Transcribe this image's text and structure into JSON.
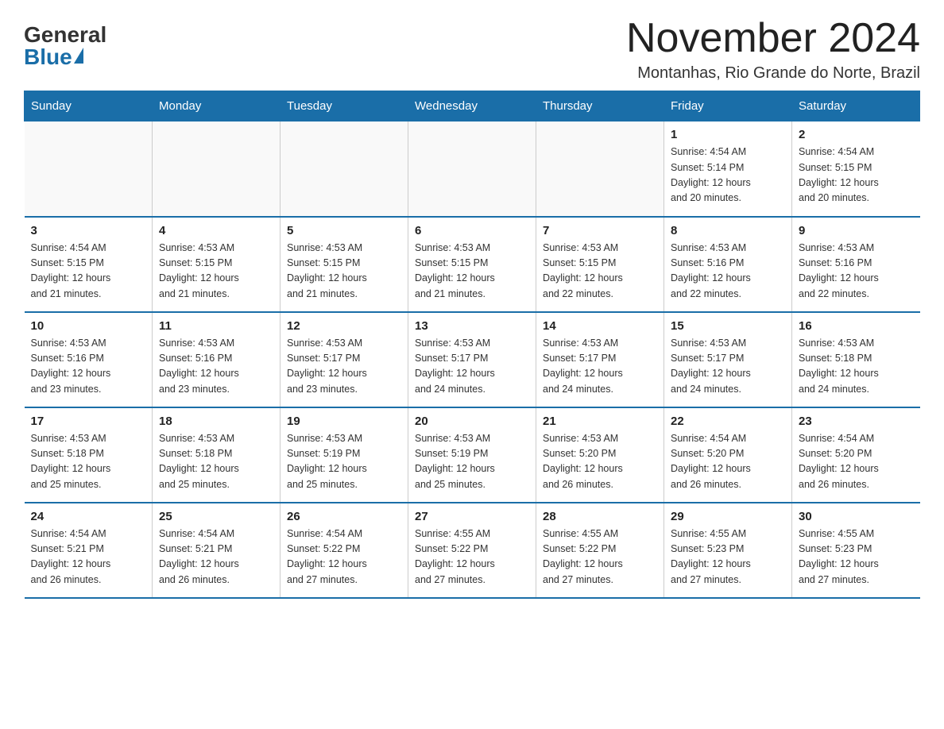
{
  "logo": {
    "general": "General",
    "blue": "Blue"
  },
  "header": {
    "title": "November 2024",
    "location": "Montanhas, Rio Grande do Norte, Brazil"
  },
  "weekdays": [
    "Sunday",
    "Monday",
    "Tuesday",
    "Wednesday",
    "Thursday",
    "Friday",
    "Saturday"
  ],
  "weeks": [
    [
      {
        "day": "",
        "info": ""
      },
      {
        "day": "",
        "info": ""
      },
      {
        "day": "",
        "info": ""
      },
      {
        "day": "",
        "info": ""
      },
      {
        "day": "",
        "info": ""
      },
      {
        "day": "1",
        "info": "Sunrise: 4:54 AM\nSunset: 5:14 PM\nDaylight: 12 hours\nand 20 minutes."
      },
      {
        "day": "2",
        "info": "Sunrise: 4:54 AM\nSunset: 5:15 PM\nDaylight: 12 hours\nand 20 minutes."
      }
    ],
    [
      {
        "day": "3",
        "info": "Sunrise: 4:54 AM\nSunset: 5:15 PM\nDaylight: 12 hours\nand 21 minutes."
      },
      {
        "day": "4",
        "info": "Sunrise: 4:53 AM\nSunset: 5:15 PM\nDaylight: 12 hours\nand 21 minutes."
      },
      {
        "day": "5",
        "info": "Sunrise: 4:53 AM\nSunset: 5:15 PM\nDaylight: 12 hours\nand 21 minutes."
      },
      {
        "day": "6",
        "info": "Sunrise: 4:53 AM\nSunset: 5:15 PM\nDaylight: 12 hours\nand 21 minutes."
      },
      {
        "day": "7",
        "info": "Sunrise: 4:53 AM\nSunset: 5:15 PM\nDaylight: 12 hours\nand 22 minutes."
      },
      {
        "day": "8",
        "info": "Sunrise: 4:53 AM\nSunset: 5:16 PM\nDaylight: 12 hours\nand 22 minutes."
      },
      {
        "day": "9",
        "info": "Sunrise: 4:53 AM\nSunset: 5:16 PM\nDaylight: 12 hours\nand 22 minutes."
      }
    ],
    [
      {
        "day": "10",
        "info": "Sunrise: 4:53 AM\nSunset: 5:16 PM\nDaylight: 12 hours\nand 23 minutes."
      },
      {
        "day": "11",
        "info": "Sunrise: 4:53 AM\nSunset: 5:16 PM\nDaylight: 12 hours\nand 23 minutes."
      },
      {
        "day": "12",
        "info": "Sunrise: 4:53 AM\nSunset: 5:17 PM\nDaylight: 12 hours\nand 23 minutes."
      },
      {
        "day": "13",
        "info": "Sunrise: 4:53 AM\nSunset: 5:17 PM\nDaylight: 12 hours\nand 24 minutes."
      },
      {
        "day": "14",
        "info": "Sunrise: 4:53 AM\nSunset: 5:17 PM\nDaylight: 12 hours\nand 24 minutes."
      },
      {
        "day": "15",
        "info": "Sunrise: 4:53 AM\nSunset: 5:17 PM\nDaylight: 12 hours\nand 24 minutes."
      },
      {
        "day": "16",
        "info": "Sunrise: 4:53 AM\nSunset: 5:18 PM\nDaylight: 12 hours\nand 24 minutes."
      }
    ],
    [
      {
        "day": "17",
        "info": "Sunrise: 4:53 AM\nSunset: 5:18 PM\nDaylight: 12 hours\nand 25 minutes."
      },
      {
        "day": "18",
        "info": "Sunrise: 4:53 AM\nSunset: 5:18 PM\nDaylight: 12 hours\nand 25 minutes."
      },
      {
        "day": "19",
        "info": "Sunrise: 4:53 AM\nSunset: 5:19 PM\nDaylight: 12 hours\nand 25 minutes."
      },
      {
        "day": "20",
        "info": "Sunrise: 4:53 AM\nSunset: 5:19 PM\nDaylight: 12 hours\nand 25 minutes."
      },
      {
        "day": "21",
        "info": "Sunrise: 4:53 AM\nSunset: 5:20 PM\nDaylight: 12 hours\nand 26 minutes."
      },
      {
        "day": "22",
        "info": "Sunrise: 4:54 AM\nSunset: 5:20 PM\nDaylight: 12 hours\nand 26 minutes."
      },
      {
        "day": "23",
        "info": "Sunrise: 4:54 AM\nSunset: 5:20 PM\nDaylight: 12 hours\nand 26 minutes."
      }
    ],
    [
      {
        "day": "24",
        "info": "Sunrise: 4:54 AM\nSunset: 5:21 PM\nDaylight: 12 hours\nand 26 minutes."
      },
      {
        "day": "25",
        "info": "Sunrise: 4:54 AM\nSunset: 5:21 PM\nDaylight: 12 hours\nand 26 minutes."
      },
      {
        "day": "26",
        "info": "Sunrise: 4:54 AM\nSunset: 5:22 PM\nDaylight: 12 hours\nand 27 minutes."
      },
      {
        "day": "27",
        "info": "Sunrise: 4:55 AM\nSunset: 5:22 PM\nDaylight: 12 hours\nand 27 minutes."
      },
      {
        "day": "28",
        "info": "Sunrise: 4:55 AM\nSunset: 5:22 PM\nDaylight: 12 hours\nand 27 minutes."
      },
      {
        "day": "29",
        "info": "Sunrise: 4:55 AM\nSunset: 5:23 PM\nDaylight: 12 hours\nand 27 minutes."
      },
      {
        "day": "30",
        "info": "Sunrise: 4:55 AM\nSunset: 5:23 PM\nDaylight: 12 hours\nand 27 minutes."
      }
    ]
  ]
}
